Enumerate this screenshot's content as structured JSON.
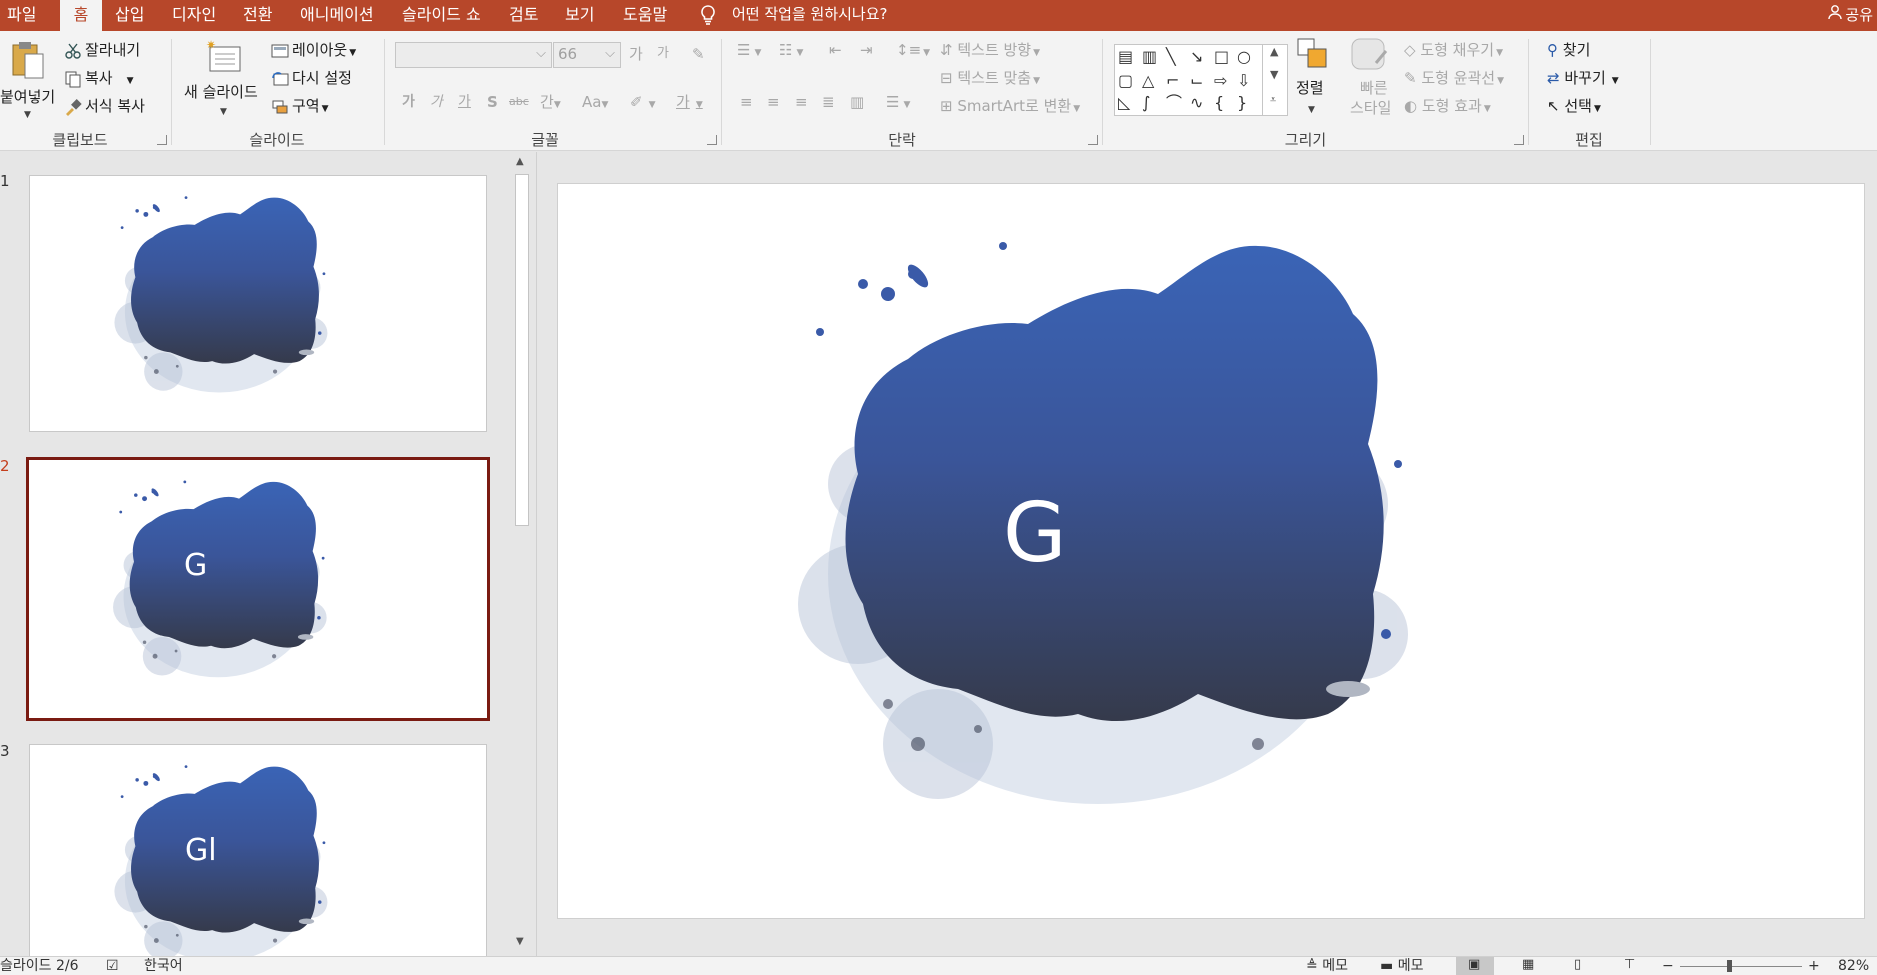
{
  "tabs": [
    {
      "label": "파일",
      "active": false
    },
    {
      "label": "홈",
      "active": true
    },
    {
      "label": "삽입",
      "active": false
    },
    {
      "label": "디자인",
      "active": false
    },
    {
      "label": "전환",
      "active": false
    },
    {
      "label": "애니메이션",
      "active": false
    },
    {
      "label": "슬라이드 쇼",
      "active": false
    },
    {
      "label": "검토",
      "active": false
    },
    {
      "label": "보기",
      "active": false
    },
    {
      "label": "도움말",
      "active": false
    }
  ],
  "tell_me": "어떤 작업을 원하시나요?",
  "share_label": "공유",
  "clipboard": {
    "group_label": "클립보드",
    "paste_label": "붙여넣기",
    "cut_label": "잘라내기",
    "copy_label": "복사",
    "format_painter_label": "서식 복사"
  },
  "slides_group": {
    "group_label": "슬라이드",
    "new_slide_label": "새 슬라이드",
    "layout_label": "레이아웃",
    "reset_label": "다시 설정",
    "section_label": "구역"
  },
  "font_group": {
    "group_label": "글꼴",
    "font_name_value": "",
    "font_size_value": "66",
    "grow_label": "가",
    "shrink_label": "가",
    "bold_label": "가",
    "italic_label": "가",
    "underline_label": "가",
    "shadow_label": "S",
    "strike_label": "abc",
    "spacing_label": "간",
    "case_label": "Aa",
    "highlight_label": "가",
    "color_label": "가"
  },
  "paragraph_group": {
    "group_label": "단락",
    "text_direction_label": "텍스트 방향",
    "align_text_label": "텍스트 맞춤",
    "smartart_label": "SmartArt로 변환"
  },
  "drawing_group": {
    "group_label": "그리기",
    "arrange_label": "정렬",
    "quick_styles_label_1": "빠른",
    "quick_styles_label_2": "스타일",
    "shape_fill_label": "도형 채우기",
    "shape_outline_label": "도형 윤곽선",
    "shape_effects_label": "도형 효과"
  },
  "editing_group": {
    "group_label": "편집",
    "find_label": "찾기",
    "replace_label": "바꾸기",
    "select_label": "선택"
  },
  "thumbnails": [
    {
      "number": "1",
      "text": "",
      "selected": false
    },
    {
      "number": "2",
      "text": "G",
      "selected": true
    },
    {
      "number": "3",
      "text": "Gl",
      "selected": false
    }
  ],
  "main_slide": {
    "text": "G"
  },
  "colors": {
    "accent": "#b7472a",
    "blob_top": "#3a64b6",
    "blob_bottom": "#353a4b",
    "selection_border": "#7a1b12"
  },
  "status": {
    "slide_indicator": "슬라이드 2/6",
    "language": "한국어",
    "notes_label": "메모",
    "comments_label": "메모",
    "zoom_minus": "−",
    "zoom_plus": "+",
    "zoom_value": "82%"
  }
}
